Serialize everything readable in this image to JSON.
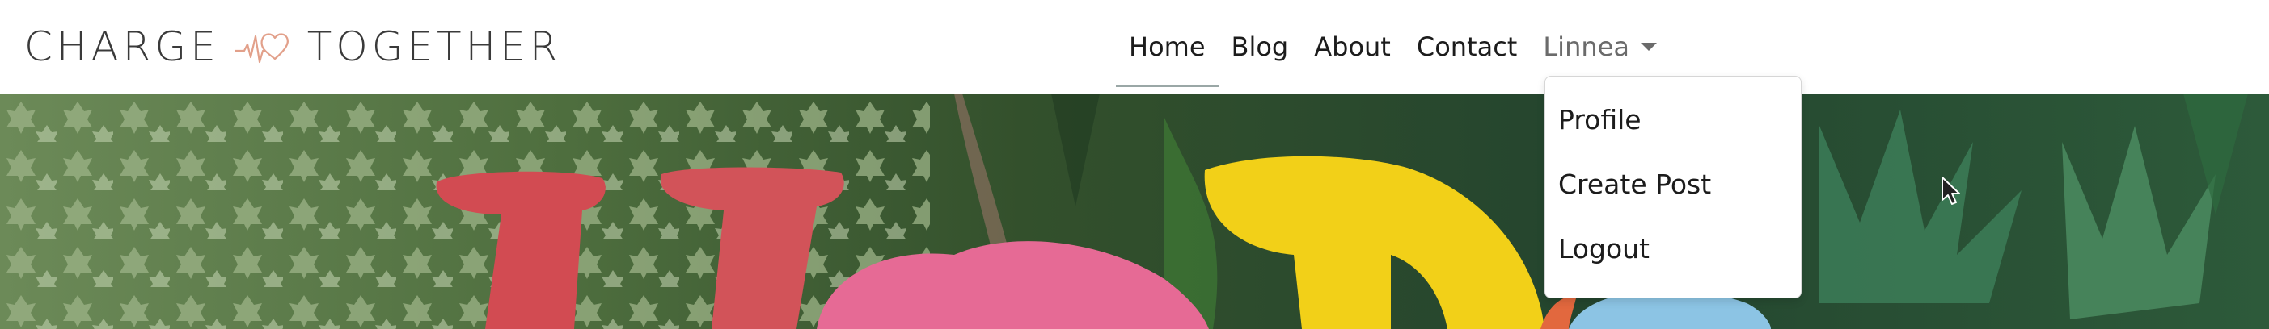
{
  "brand": {
    "word_left": "CHARGE",
    "word_right": "TOGETHER",
    "heart_color": "#e2a08a"
  },
  "nav": {
    "items": [
      {
        "label": "Home",
        "active": true
      },
      {
        "label": "Blog"
      },
      {
        "label": "About"
      },
      {
        "label": "Contact"
      }
    ],
    "user": {
      "label": "Linnea"
    }
  },
  "user_menu": {
    "items": [
      {
        "label": "Profile"
      },
      {
        "label": "Create Post"
      },
      {
        "label": "Logout"
      }
    ]
  },
  "colors": {
    "active_underline": "#9aa7a6",
    "text": "#1c1c1c",
    "muted": "#6b6b6b"
  }
}
